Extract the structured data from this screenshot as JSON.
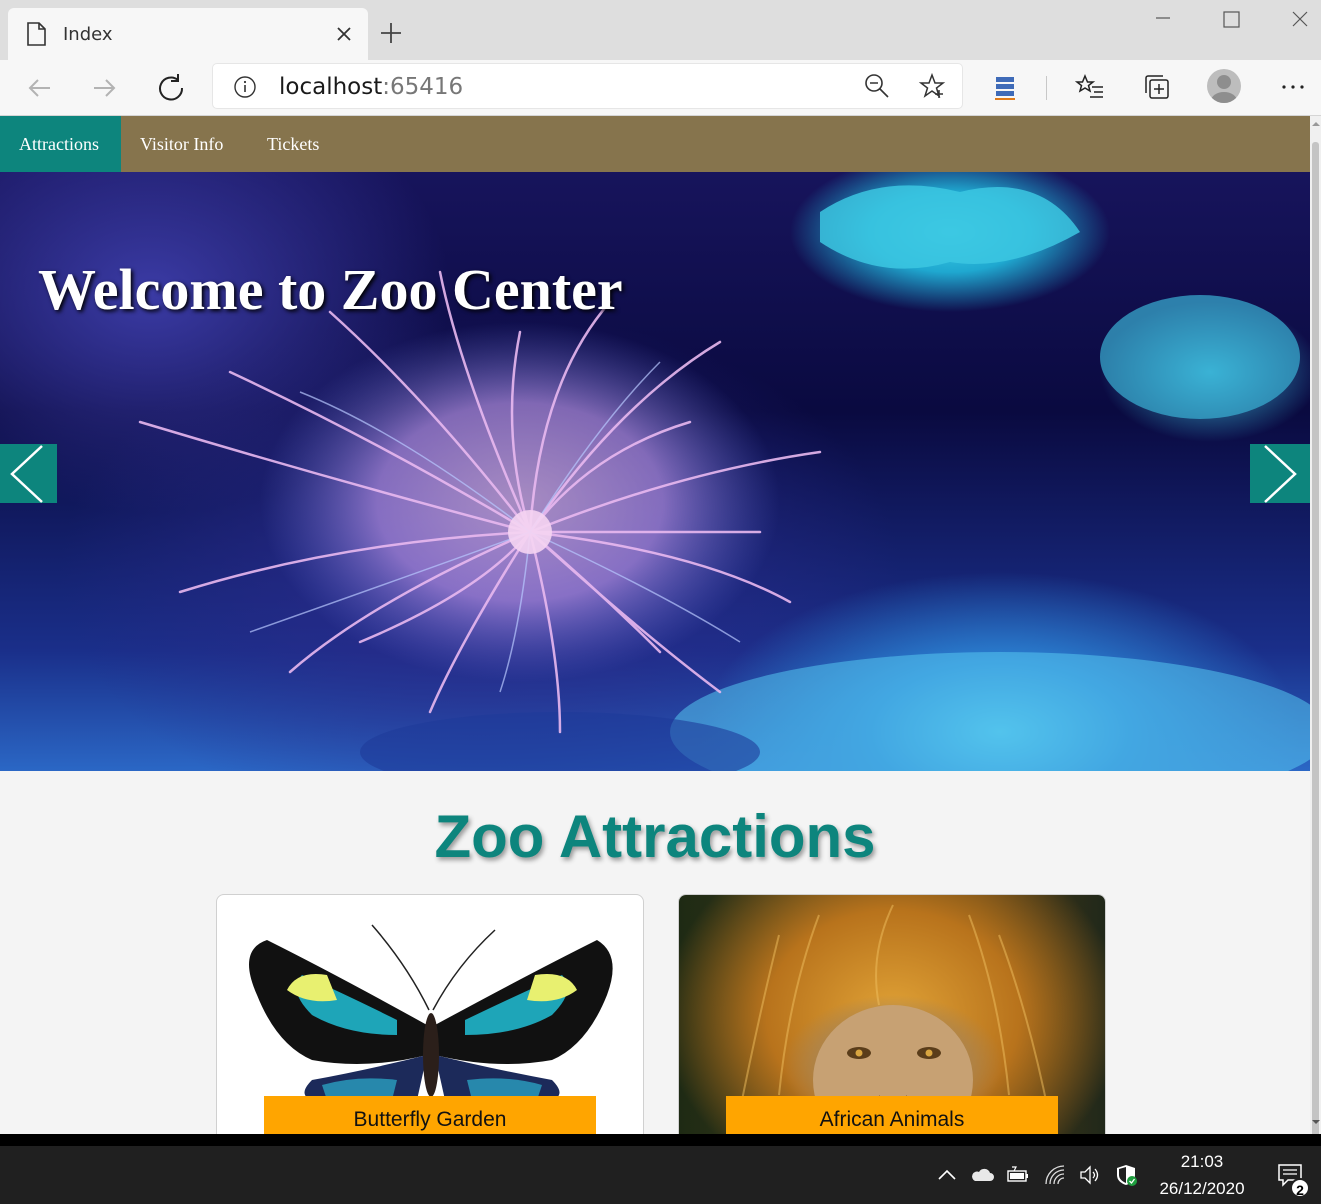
{
  "browser": {
    "tab_title": "Index",
    "url_host": "localhost",
    "url_port": ":65416"
  },
  "site": {
    "nav": [
      {
        "label": "Attractions",
        "active": true
      },
      {
        "label": "Visitor Info",
        "active": false
      },
      {
        "label": "Tickets",
        "active": false
      }
    ],
    "hero_title": "Welcome to Zoo Center",
    "section_title": "Zoo Attractions",
    "cards": [
      {
        "label": "Butterfly Garden"
      },
      {
        "label": "African Animals"
      }
    ],
    "colors": {
      "accent": "#0d857d",
      "nav_bg": "#86744d",
      "card_label_bg": "#ffa500"
    }
  },
  "taskbar": {
    "time": "21:03",
    "date": "26/12/2020",
    "notification_count": "2"
  }
}
